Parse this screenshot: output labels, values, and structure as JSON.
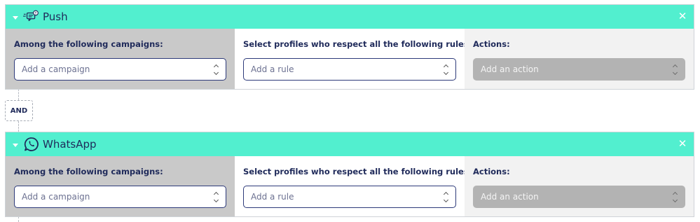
{
  "colors": {
    "header_bg": "#52efcf",
    "text_navy": "#1f2a5a",
    "campaigns_col_bg": "#c9c9c9",
    "actions_col_bg": "#f2f2f2",
    "disabled_select_bg": "#b3b3b3"
  },
  "blocks": [
    {
      "title": "Push",
      "icon": "push-notification-icon",
      "columns": {
        "campaigns": {
          "label": "Among the following campaigns:",
          "placeholder": "Add a campaign"
        },
        "rules": {
          "label": "Select profiles who respect all the following rules:",
          "placeholder": "Add a rule"
        },
        "actions": {
          "label": "Actions:",
          "placeholder": "Add an action"
        }
      }
    },
    {
      "title": "WhatsApp",
      "icon": "whatsapp-icon",
      "columns": {
        "campaigns": {
          "label": "Among the following campaigns:",
          "placeholder": "Add a campaign"
        },
        "rules": {
          "label": "Select profiles who respect all the following rules:",
          "placeholder": "Add a rule"
        },
        "actions": {
          "label": "Actions:",
          "placeholder": "Add an action"
        }
      }
    }
  ],
  "operator": {
    "label": "AND"
  }
}
